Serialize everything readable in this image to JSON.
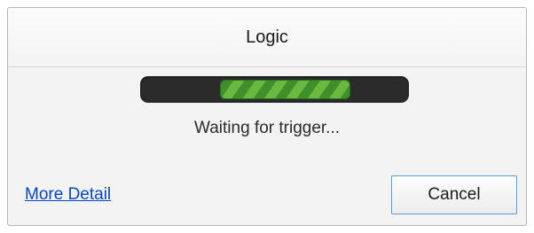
{
  "dialog": {
    "title": "Logic",
    "status_text": "Waiting for trigger...",
    "more_detail_label": "More Detail",
    "cancel_label": "Cancel"
  },
  "progress": {
    "mode": "indeterminate"
  },
  "colors": {
    "progress_track": "#2b2b2b",
    "progress_fill_dark": "#3f8f2a",
    "progress_fill_light": "#6ab83f",
    "link": "#0645c9",
    "button_focus_border": "#5a9fd8"
  }
}
